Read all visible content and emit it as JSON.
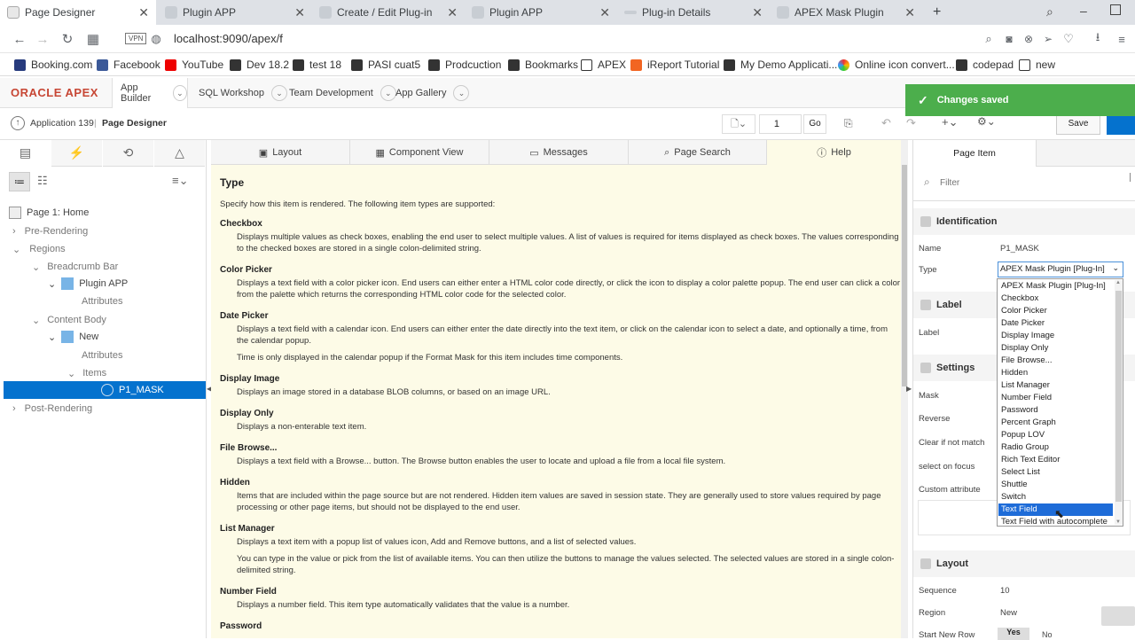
{
  "browser": {
    "tabs": [
      {
        "label": "Page Designer",
        "active": true
      },
      {
        "label": "Plugin APP"
      },
      {
        "label": "Create / Edit Plug-in"
      },
      {
        "label": "Plugin APP"
      },
      {
        "label": "Plug-in Details"
      },
      {
        "label": "APEX Mask Plugin"
      }
    ],
    "new_tab": "+",
    "address": "localhost:9090/apex/f",
    "vpn": "VPN",
    "bookmarks": [
      "Booking.com",
      "Facebook",
      "YouTube",
      "Dev 18.2",
      "test 18",
      "PASI cuat5",
      "Prodcuction",
      "Bookmarks",
      "APEX",
      "iReport Tutorial",
      "My Demo Applicati...",
      "Online icon convert...",
      "codepad",
      "new"
    ]
  },
  "apex": {
    "brand": "ORACLE  APEX",
    "nav": [
      "App Builder",
      "SQL Workshop",
      "Team Development",
      "App Gallery"
    ],
    "breadcrumb_app": "Application 139",
    "breadcrumb_page": "Page Designer",
    "page_number": "1",
    "go": "Go",
    "save": "Save",
    "toast": "Changes saved"
  },
  "left": {
    "tree": [
      {
        "label": "Page 1: Home"
      },
      {
        "label": "Pre-Rendering"
      },
      {
        "label": "Regions"
      },
      {
        "label": "Breadcrumb Bar"
      },
      {
        "label": "Plugin APP"
      },
      {
        "label": "Attributes"
      },
      {
        "label": "Content Body"
      },
      {
        "label": "New"
      },
      {
        "label": "Attributes"
      },
      {
        "label": "Items"
      },
      {
        "label": "P1_MASK"
      },
      {
        "label": "Post-Rendering"
      }
    ]
  },
  "center": {
    "tabs": [
      "Layout",
      "Component View",
      "Messages",
      "Page Search",
      "Help"
    ],
    "title": "Type",
    "intro": "Specify how this item is rendered. The following item types are supported:",
    "items": [
      {
        "h": "Checkbox",
        "t": [
          "Displays multiple values as check boxes, enabling the end user to select multiple values. A list of values is required for items displayed as check boxes. The values corresponding",
          "to the checked boxes are stored in a single colon-delimited string."
        ]
      },
      {
        "h": "Color Picker",
        "t": [
          "Displays a text field with a color picker icon. End users can either enter a HTML color code directly, or click the icon to display a color palette popup. The end user can click a color",
          "from the palette which returns the corresponding HTML color code for the selected color."
        ]
      },
      {
        "h": "Date Picker",
        "t": [
          "Displays a text field with a calendar icon. End users can either enter the date directly into the text item, or click on the calendar icon to select a date, and optionally a time, from",
          "the calendar popup.",
          "",
          "Time is only displayed in the calendar popup if the Format Mask for this item includes time components."
        ]
      },
      {
        "h": "Display Image",
        "t": [
          "Displays an image stored in a database BLOB columns, or based on an image URL."
        ]
      },
      {
        "h": "Display Only",
        "t": [
          "Displays a non-enterable text item."
        ]
      },
      {
        "h": "File Browse...",
        "t": [
          "Displays a text field with a Browse... button. The Browse button enables the user to locate and upload a file from a local file system."
        ]
      },
      {
        "h": "Hidden",
        "t": [
          "Items that are included within the page source but are not rendered. Hidden item values are saved in session state. They are generally used to store values required by page",
          "processing or other page items, but should not be displayed to the end user."
        ]
      },
      {
        "h": "List Manager",
        "t": [
          "Displays a text item with a popup list of values icon, Add and Remove buttons, and a list of selected values.",
          "",
          "You can type in the value or pick from the list of available items. You can then utilize the buttons to manage the values selected. The selected values are stored in a single colon-",
          "delimited string."
        ]
      },
      {
        "h": "Number Field",
        "t": [
          "Displays a number field. This item type automatically validates that the value is a number."
        ]
      },
      {
        "h": "Password",
        "t": []
      }
    ]
  },
  "right": {
    "tab": "Page Item",
    "filter_placeholder": "Filter",
    "sections": {
      "identification": "Identification",
      "label": "Label",
      "settings": "Settings",
      "layout": "Layout"
    },
    "props": {
      "name_lbl": "Name",
      "name_val": "P1_MASK",
      "type_lbl": "Type",
      "type_val": "APEX Mask Plugin [Plug-In]",
      "label_lbl": "Label",
      "mask_lbl": "Mask",
      "reverse_lbl": "Reverse",
      "clear_lbl": "Clear if not match",
      "focus_lbl": "select on focus",
      "custom_lbl": "Custom attribute",
      "seq_lbl": "Sequence",
      "seq_val": "10",
      "region_lbl": "Region",
      "region_val": "New",
      "newrow_lbl": "Start New Row",
      "yes": "Yes",
      "no": "No"
    },
    "type_options": [
      "APEX Mask Plugin [Plug-In]",
      "Checkbox",
      "Color Picker",
      "Date Picker",
      "Display Image",
      "Display Only",
      "File Browse...",
      "Hidden",
      "List Manager",
      "Number Field",
      "Password",
      "Percent Graph",
      "Popup LOV",
      "Radio Group",
      "Rich Text Editor",
      "Select List",
      "Shuttle",
      "Switch",
      "Text Field",
      "Text Field with autocomplete"
    ],
    "highlighted_option": "Text Field"
  },
  "colors": {
    "accent": "#0572ce",
    "help_bg": "#fdfbe7",
    "toast": "#4cae4c"
  }
}
